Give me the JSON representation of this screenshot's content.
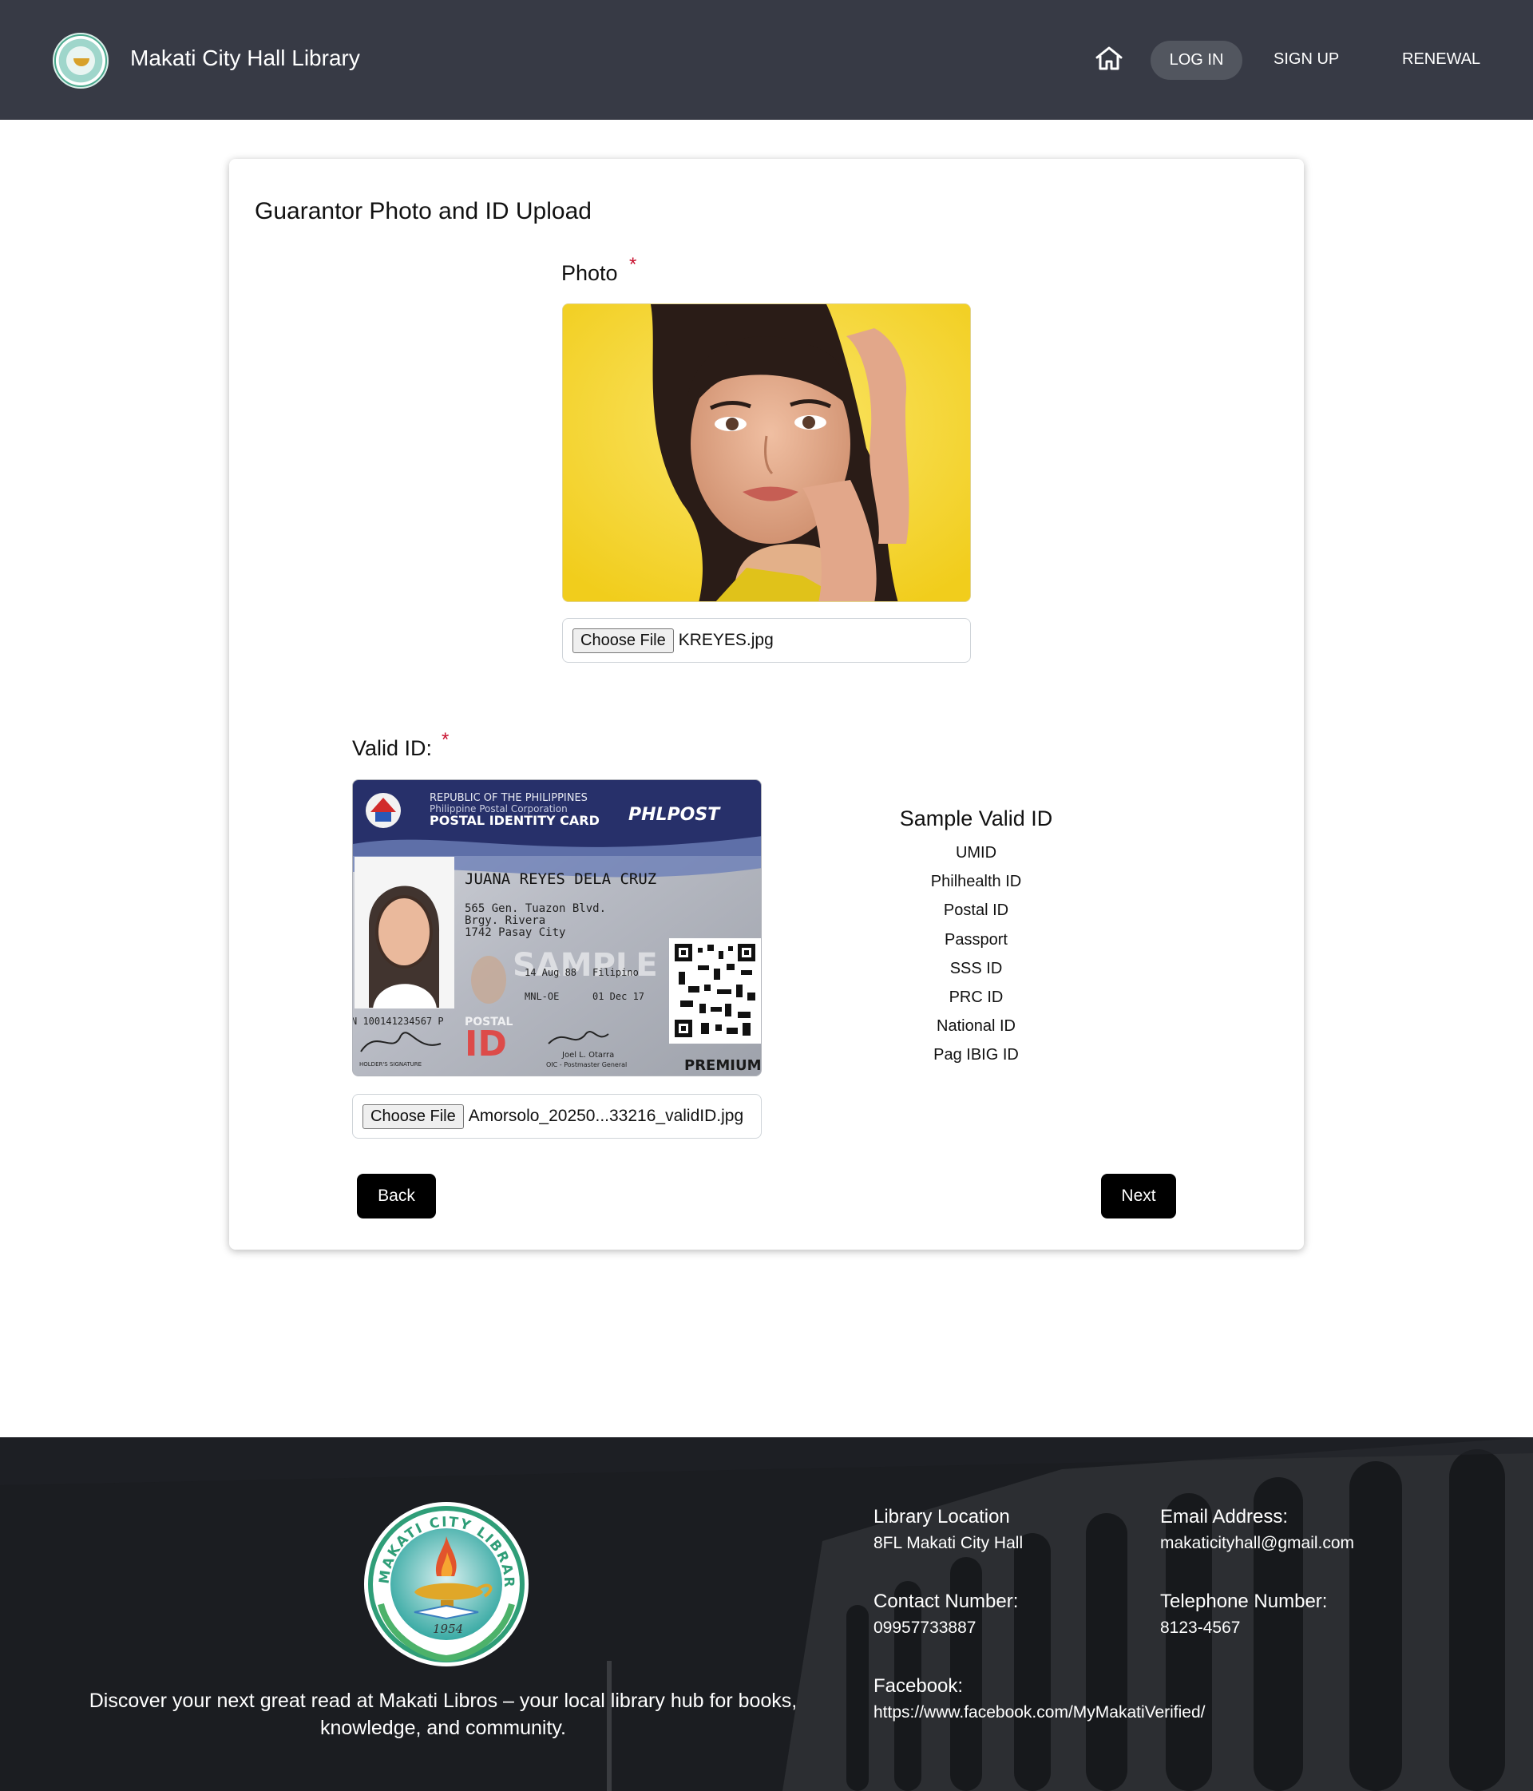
{
  "header": {
    "site_title": "Makati City Hall Library",
    "nav": {
      "login": "LOG IN",
      "signup": "SIGN UP",
      "renewal": "RENEWAL"
    }
  },
  "form": {
    "title": "Guarantor Photo and ID Upload",
    "required_mark": "*",
    "photo": {
      "label": "Photo",
      "button": "Choose File",
      "file_name": "KREYES.jpg"
    },
    "valid_id": {
      "label": "Valid ID:",
      "button": "Choose File",
      "file_name": "Amorsolo_20250...33216_validID.jpg",
      "card": {
        "republic": "REPUBLIC OF THE PHILIPPINES",
        "corp": "Philippine Postal Corporation",
        "card_type": "POSTAL IDENTITY CARD",
        "brand": "PHLPOST",
        "name": "JUANA REYES DELA CRUZ",
        "address1": "565 Gen. Tuazon Blvd.",
        "address2": "Brgy. Rivera",
        "address3": "1742 Pasay City",
        "birth": "14 Aug 88",
        "nationality": "Filipino",
        "office": "MNL-OE",
        "valid_until": "01 Dec 17",
        "prn": "N 100141234567 P",
        "sample": "SAMPLE",
        "postal": "POSTAL",
        "id_text": "ID",
        "signer": "Joel L. Otarra",
        "signer_title": "OIC - Postmaster General",
        "holder_sig": "HOLDER'S SIGNATURE",
        "premium": "PREMIUM"
      }
    },
    "sample_ids": {
      "title": "Sample Valid ID",
      "items": [
        "UMID",
        "Philhealth ID",
        "Postal ID",
        "Passport",
        "SSS ID",
        "PRC ID",
        "National ID",
        "Pag IBIG ID"
      ]
    },
    "buttons": {
      "back": "Back",
      "next": "Next"
    }
  },
  "footer": {
    "seal": {
      "top_text": "MAKATI CITY LIBRARY",
      "year": "1954"
    },
    "tagline": "Discover your next great read at Makati Libros – your local library hub for books, knowledge, and community.",
    "location_label": "Library Location",
    "location_value": "8FL Makati City Hall",
    "email_label": "Email Address:",
    "email_value": "makaticityhall@gmail.com",
    "contact_label": "Contact Number:",
    "contact_value": "09957733887",
    "telephone_label": "Telephone Number:",
    "telephone_value": "8123-4567",
    "facebook_label": "Facebook:",
    "facebook_value": "https://www.facebook.com/MyMakatiVerified/"
  }
}
